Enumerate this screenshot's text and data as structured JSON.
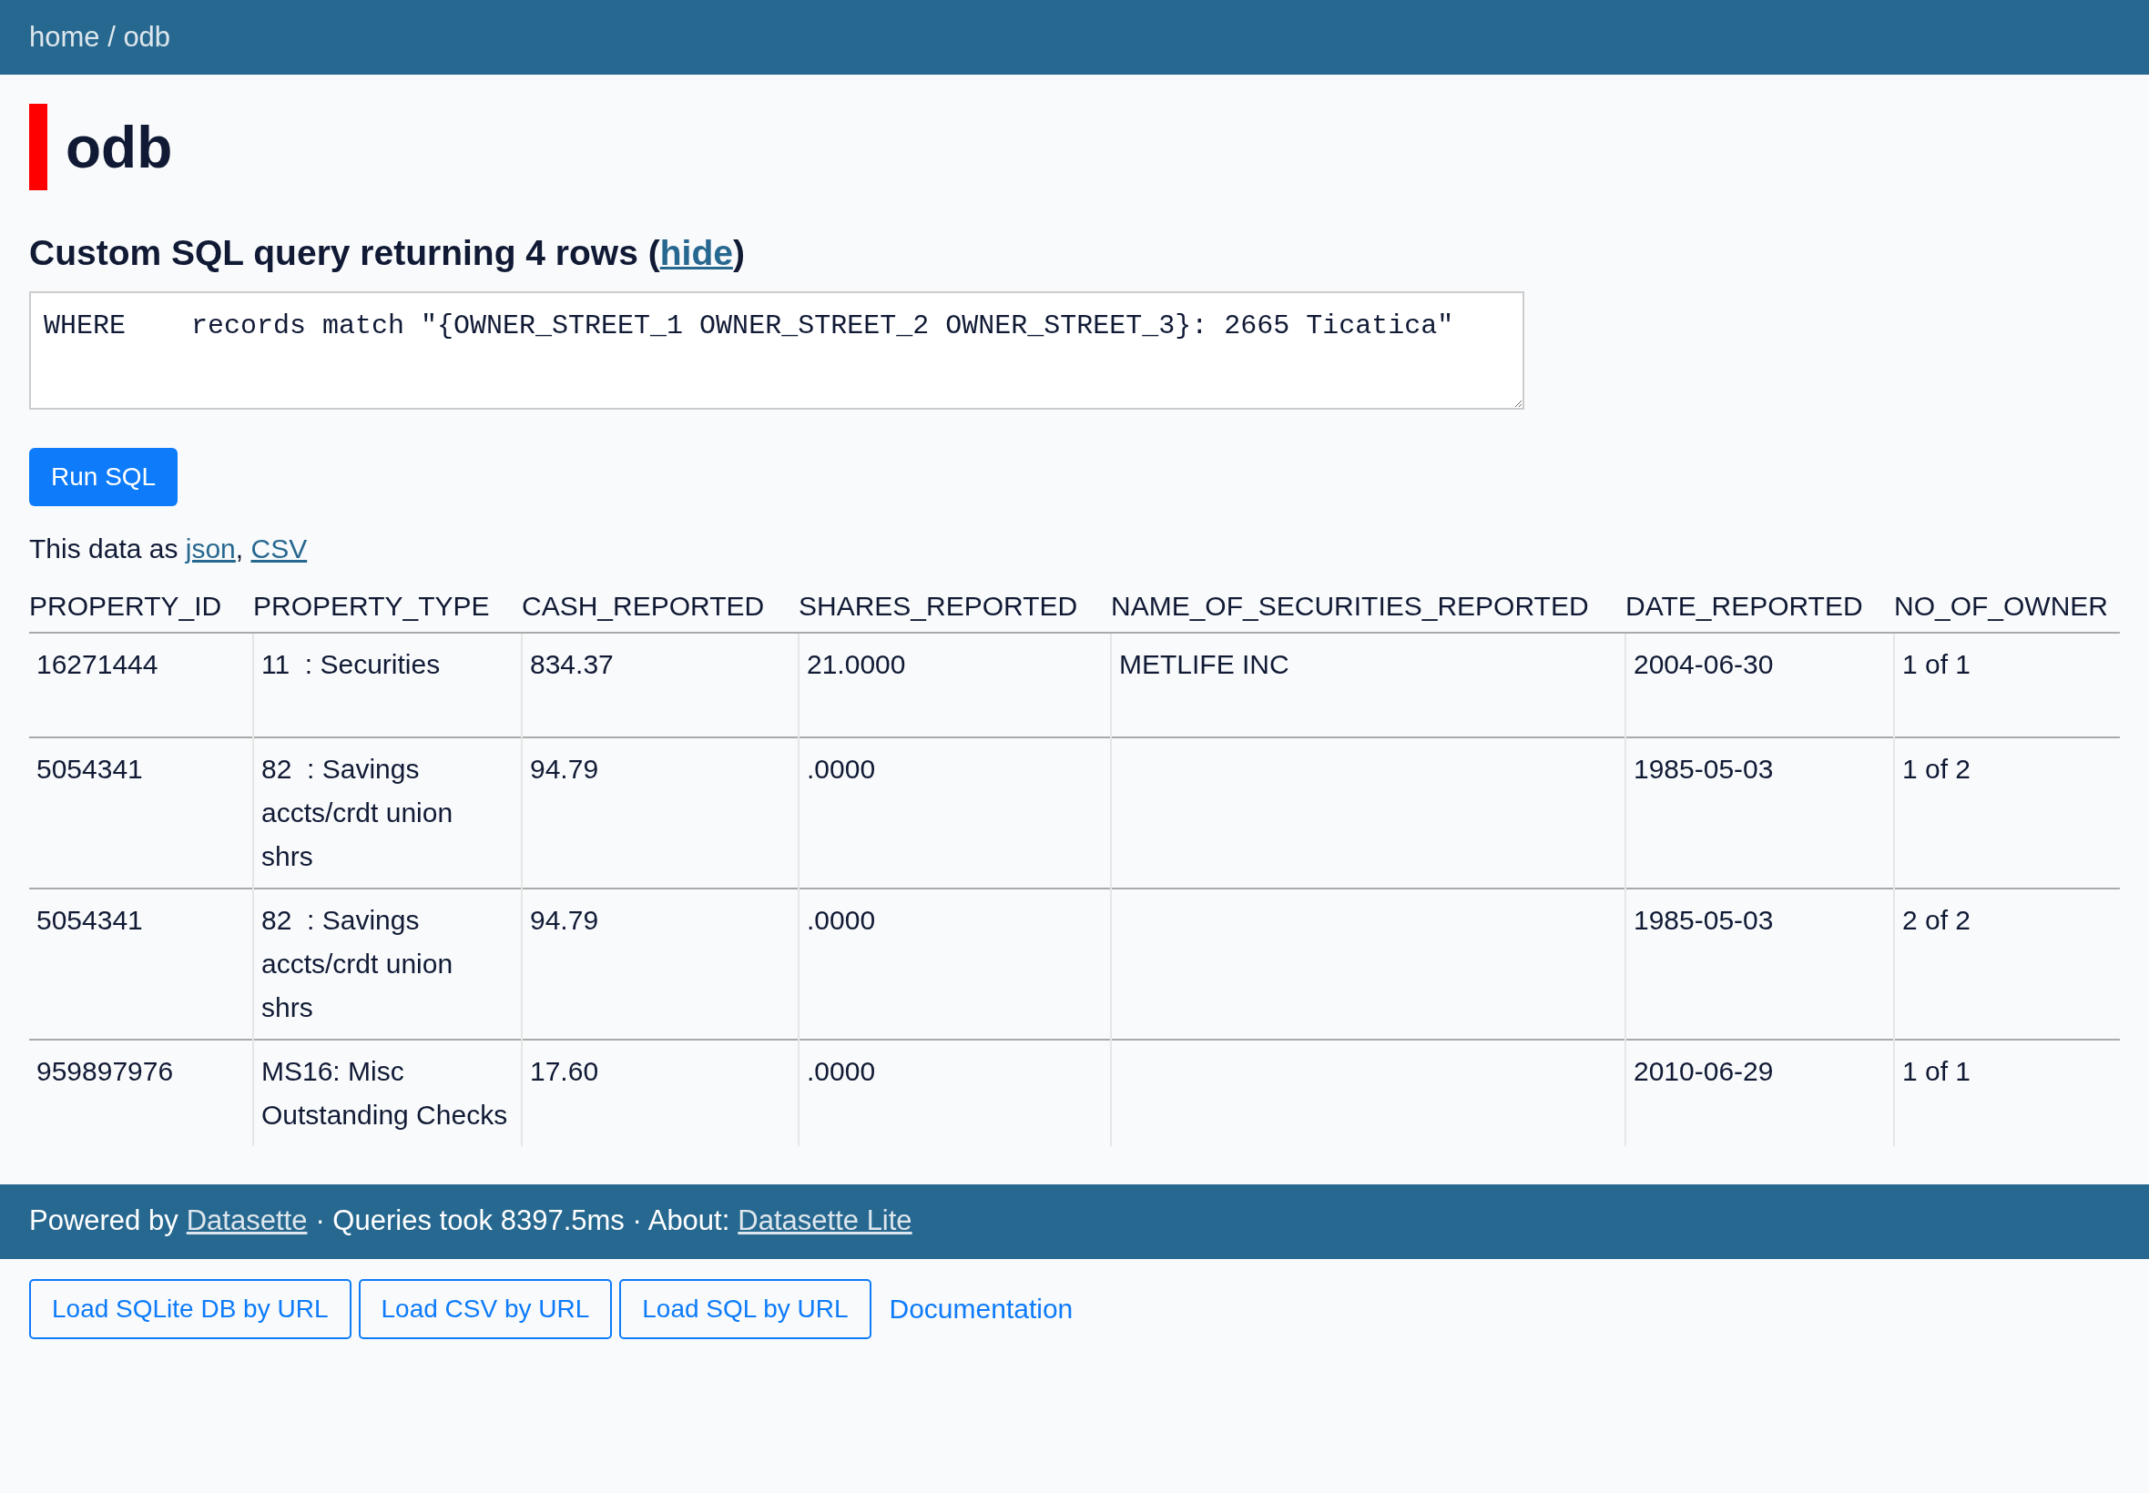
{
  "breadcrumb": "home / odb",
  "title": "odb",
  "query_heading": {
    "text": "Custom SQL query returning 4 rows (",
    "link": "hide",
    "close": ")"
  },
  "sql": "WHERE    records match \"{OWNER_STREET_1 OWNER_STREET_2 OWNER_STREET_3}: 2665 Ticatica\"",
  "run_button": "Run SQL",
  "export": {
    "text": "This data as",
    "links": [
      {
        "label": "json",
        "suffix": ","
      },
      {
        "label": "CSV"
      }
    ]
  },
  "table": {
    "columns": [
      "PROPERTY_ID",
      "PROPERTY_TYPE",
      "CASH_REPORTED",
      "SHARES_REPORTED",
      "NAME_OF_SECURITIES_REPORTED",
      "DATE_REPORTED",
      "NO_OF_OWNER"
    ],
    "rows": [
      [
        "16271444",
        "11  : Securities",
        "834.37",
        "21.0000",
        "METLIFE INC",
        "2004-06-30",
        "1 of 1"
      ],
      [
        "5054341",
        "82  : Savings accts/crdt union shrs",
        "94.79",
        ".0000",
        null,
        "1985-05-03",
        "1 of 2"
      ],
      [
        "5054341",
        "82  : Savings accts/crdt union shrs",
        "94.79",
        ".0000",
        null,
        "1985-05-03",
        "2 of 2"
      ],
      [
        "959897976",
        "MS16: Misc Outstanding Checks",
        "17.60",
        ".0000",
        null,
        "2010-06-29",
        "1 of 1"
      ]
    ]
  },
  "footer": [
    {
      "kind": "text",
      "text": "Powered by"
    },
    {
      "kind": "link",
      "text": "Datasette"
    },
    {
      "kind": "text",
      "text": "· Queries took 8397.5ms · About:"
    },
    {
      "kind": "link",
      "text": "Datasette Lite"
    }
  ],
  "buttons": [
    "Load SQLite DB by URL",
    "Load CSV by URL",
    "Load SQL by URL"
  ],
  "doc_link": "Documentation"
}
